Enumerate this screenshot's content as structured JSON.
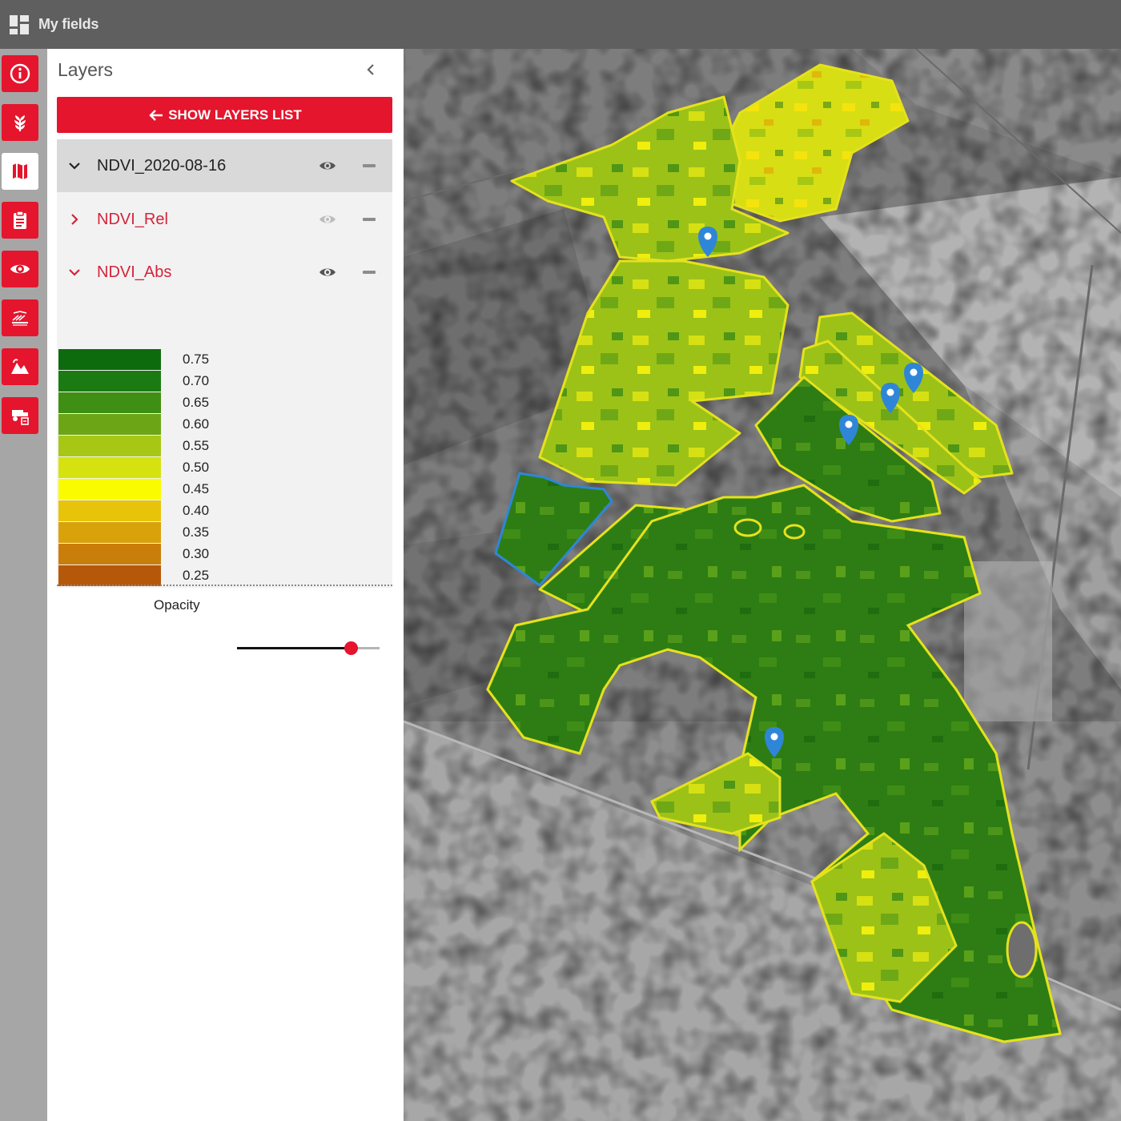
{
  "topbar": {
    "title": "My fields",
    "icon": "dashboard-grid-icon"
  },
  "rail": {
    "items": [
      {
        "icon": "info-icon",
        "active": false
      },
      {
        "icon": "crop-wheat-icon",
        "active": false
      },
      {
        "icon": "map-icon",
        "active": true
      },
      {
        "icon": "clipboard-icon",
        "active": false
      },
      {
        "icon": "eye-icon",
        "active": false
      },
      {
        "icon": "field-work-icon",
        "active": false
      },
      {
        "icon": "landscape-icon",
        "active": false
      },
      {
        "icon": "machinery-icon",
        "active": false
      }
    ]
  },
  "panel": {
    "title": "Layers",
    "show_layers_button": "SHOW LAYERS LIST",
    "layers": [
      {
        "name": "NDVI_2020-08-16",
        "expanded": true,
        "selected": true,
        "visible": true
      },
      {
        "name": "NDVI_Rel",
        "expanded": false,
        "selected": false,
        "visible": false
      },
      {
        "name": "NDVI_Abs",
        "expanded": true,
        "selected": false,
        "visible": true
      }
    ],
    "legend": [
      {
        "label": "0.75",
        "color": "#0d6b0d"
      },
      {
        "label": "0.70",
        "color": "#1c7a12"
      },
      {
        "label": "0.65",
        "color": "#3e8f14"
      },
      {
        "label": "0.60",
        "color": "#6ca516"
      },
      {
        "label": "0.55",
        "color": "#a7c715"
      },
      {
        "label": "0.50",
        "color": "#d5e20f"
      },
      {
        "label": "0.45",
        "color": "#fbfb00"
      },
      {
        "label": "0.40",
        "color": "#e7c40a"
      },
      {
        "label": "0.35",
        "color": "#d9a20a"
      },
      {
        "label": "0.30",
        "color": "#c97d0a"
      },
      {
        "label": "0.25",
        "color": "#b6580a"
      }
    ],
    "opacity_label": "Opacity",
    "opacity_value": 0.8
  },
  "colors": {
    "accent": "#e4152d",
    "topbar": "#5f5f5f",
    "field_outline": "#e5e21c",
    "selected_outline": "#2f86d6",
    "marker": "#2f86d6"
  }
}
